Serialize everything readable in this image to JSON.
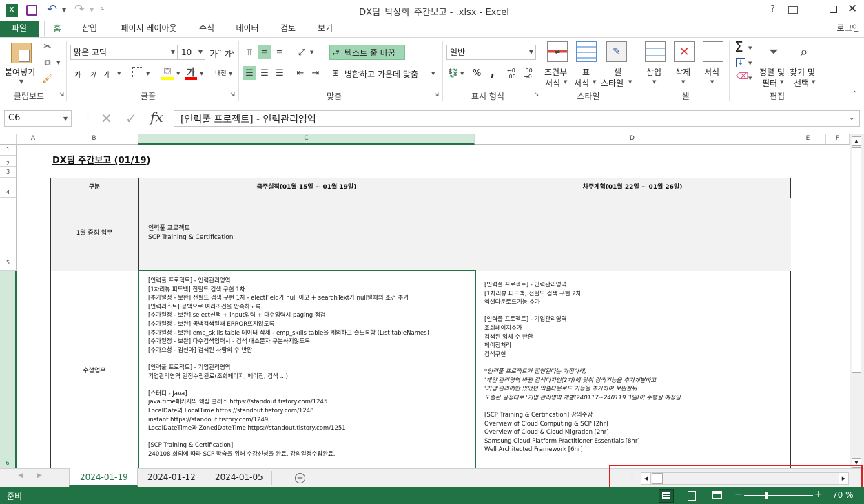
{
  "window": {
    "title": "DX팀_박상희_주간보고 - .xlsx - Excel",
    "user": "로그인"
  },
  "tabs": {
    "file": "파일",
    "items": [
      "홈",
      "삽입",
      "페이지 레이아웃",
      "수식",
      "데이터",
      "검토",
      "보기"
    ],
    "active": "홈"
  },
  "ribbon": {
    "clipboard": {
      "paste": "붙여넣기",
      "label": "클립보드"
    },
    "font": {
      "name": "맑은 고딕",
      "size": "10",
      "label": "글꼴",
      "bold": "가",
      "italic": "가",
      "underline": "가",
      "phonetic": "내천"
    },
    "align": {
      "wrap": "텍스트 줄 바꿈",
      "merge": "병합하고 가운데 맞춤",
      "label": "맞춤"
    },
    "number": {
      "format": "일반",
      "label": "표시 형식"
    },
    "styles": {
      "cond1": "조건부",
      "cond2": "서식",
      "table1": "표",
      "table2": "서식",
      "cell1": "셀",
      "cell2": "스타일",
      "label": "스타일"
    },
    "cells": {
      "insert": "삽입",
      "delete": "삭제",
      "format": "서식",
      "label": "셀"
    },
    "editing": {
      "sort1": "정렬 및",
      "sort2": "필터",
      "find1": "찾기 및",
      "find2": "선택",
      "label": "편집"
    }
  },
  "formula": {
    "namebox": "C6",
    "fx": "fx",
    "value": "[인력풀 프로젝트] - 인력관리영역"
  },
  "columns": [
    "A",
    "B",
    "C",
    "D",
    "E",
    "F"
  ],
  "rows": [
    "1",
    "2",
    "3",
    "4",
    "5",
    "6"
  ],
  "sheet": {
    "title": "DX팀 주간보고 (01/19)",
    "header": {
      "col1": "구분",
      "col2": "금주실적(01월 15일 ~ 01월 19일)",
      "col3": "차주계획(01월 22일 ~ 01월 26일)"
    },
    "row5": {
      "cat": "1월 중점 업무",
      "current": [
        "인력풀 프로젝트",
        "SCP Training & Certification"
      ]
    },
    "row6": {
      "cat": "수행업무",
      "current": [
        "[인력풀 프로젝트] - 인력관리영역",
        "[1차리뷰 피드백] 전필드 검색 구현 1차",
        "[추가일정 - 보완] 전필드 검색 구현 1차 - electField가 null 이고 + searchText가 null일때의 조건 추가",
        "[인력리스트] 공백으로 여러조건을 만족하도록.",
        "[추가일정 - 보완] select선택 + input입력  + 다수입력시 paging 점검",
        "[추가일정 - 보완] 공백검색일때 ERROR뜨지않도록",
        "[추가일정 - 보완] emp_skills table 데이터 삭제 - emp_skills table을 제외하고 출도록함 (List tableNames)",
        "[추가일정 - 보완] 다수검색입력시 - 검색 대소문자 구분하지않도록",
        "[추가요청 - 김현아] 검색된 사람의 수 반환",
        "",
        "[인력풀 프로젝트] - 기업관리영역",
        "기업관리영역 일정수립완료(조회페이지, 페이징, 검색 ...)",
        "",
        "[스터디 - Java]",
        "java.time패키지의 핵심 클래스 https://standout.tistory.com/1245",
        "LocalDate와 LocalTime https://standout.tistory.com/1248",
        "instant https://standout.tistory.com/1249",
        "LocalDateTime과 ZonedDateTime https://standout.tistory.com/1251",
        "",
        "[SCP Training & Certification]",
        "240108 회의에 따라 SCP 학습을 위해 수강신청을 완료, 강의일정수립완료."
      ],
      "next": [
        "[인력풀 프로젝트] - 인력관리영역",
        "[1차리뷰 피드백] 전필드 검색 구현 2차",
        "엑셀다운로드기능 추가",
        "",
        "[인력풀 프로젝트] - 기업관리영역",
        "조회페이지추가",
        "검색된 업체 수 반환",
        "페이징처리",
        "검색구현",
        "",
        "*인력풀 프로젝트가 진행된다는 가정아래,",
        "'개인'관리영역 바뀐 검색디자인(2차)에 맞춰 검색기능을 추가개발하고",
        "'기업'관리에만 있었던 엑셀다운로드 기능을 추가하여 보완한뒤",
        "도출된 일정대로 '기업'관리영역 개발(240117~240119 3일)이 수행될 예정임.",
        "",
        "[SCP Training & Certification] 강의수강",
        "Overview of Cloud Computing & SCP [2hr]",
        "Overview of Cloud & Cloud Migration [2hr]",
        "Samsung Cloud Platform Practitioner Essentials [8hr]",
        "Well Architected Framework [6hr]"
      ]
    }
  },
  "sheettabs": [
    "2024-01-19",
    "2024-01-12",
    "2024-01-05"
  ],
  "status": {
    "ready": "준비",
    "zoom": "70 %"
  },
  "colors": {
    "accent": "#217346",
    "highlight": "#e02020"
  }
}
